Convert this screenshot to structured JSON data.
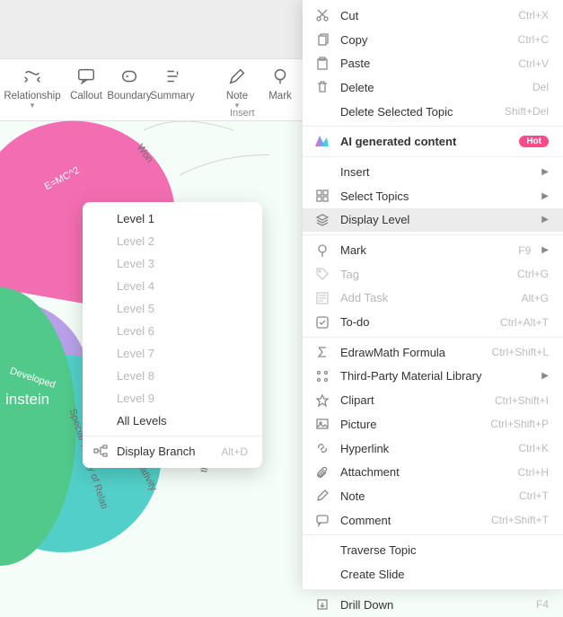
{
  "toolbar": {
    "items": [
      {
        "label": "Relationship",
        "caret": true
      },
      {
        "label": "Callout",
        "caret": false
      },
      {
        "label": "Boundary",
        "caret": false
      },
      {
        "label": "Summary",
        "caret": false
      },
      {
        "label": "Note",
        "caret": true
      },
      {
        "label": "Mark",
        "caret": true
      }
    ],
    "group_label": "Insert"
  },
  "canvas": {
    "center_label": "instein",
    "topic_emc2": "E=MC^2",
    "topic_developed": "Developed",
    "topic_won": "Won",
    "topic_special": "Special Theory of Relati",
    "topic_theory": "theory",
    "topic_relativity": "of Relativity"
  },
  "submenu": {
    "levels": [
      "Level 1",
      "Level 2",
      "Level 3",
      "Level 4",
      "Level 5",
      "Level 6",
      "Level 7",
      "Level 8",
      "Level 9"
    ],
    "all": "All Levels",
    "display_branch": "Display Branch",
    "display_branch_shortcut": "Alt+D"
  },
  "menu": {
    "cut": {
      "label": "Cut",
      "shortcut": "Ctrl+X"
    },
    "copy": {
      "label": "Copy",
      "shortcut": "Ctrl+C"
    },
    "paste": {
      "label": "Paste",
      "shortcut": "Ctrl+V"
    },
    "delete": {
      "label": "Delete",
      "shortcut": "Del"
    },
    "delete_selected": {
      "label": "Delete Selected Topic",
      "shortcut": "Shift+Del"
    },
    "ai": {
      "label": "AI generated content",
      "badge": "Hot"
    },
    "insert": {
      "label": "Insert"
    },
    "select_topics": {
      "label": "Select Topics"
    },
    "display_level": {
      "label": "Display Level"
    },
    "mark": {
      "label": "Mark",
      "shortcut": "F9"
    },
    "tag": {
      "label": "Tag",
      "shortcut": "Ctrl+G"
    },
    "add_task": {
      "label": "Add Task",
      "shortcut": "Alt+G"
    },
    "todo": {
      "label": "To-do",
      "shortcut": "Ctrl+Alt+T"
    },
    "edrawmath": {
      "label": "EdrawMath Formula",
      "shortcut": "Ctrl+Shift+L"
    },
    "third_party": {
      "label": "Third-Party Material Library"
    },
    "clipart": {
      "label": "Clipart",
      "shortcut": "Ctrl+Shift+I"
    },
    "picture": {
      "label": "Picture",
      "shortcut": "Ctrl+Shift+P"
    },
    "hyperlink": {
      "label": "Hyperlink",
      "shortcut": "Ctrl+K"
    },
    "attachment": {
      "label": "Attachment",
      "shortcut": "Ctrl+H"
    },
    "note": {
      "label": "Note",
      "shortcut": "Ctrl+T"
    },
    "comment": {
      "label": "Comment",
      "shortcut": "Ctrl+Shift+T"
    },
    "traverse": {
      "label": "Traverse Topic"
    },
    "create_slide": {
      "label": "Create Slide"
    },
    "drill_down": {
      "label": "Drill Down",
      "shortcut": "F4"
    }
  }
}
